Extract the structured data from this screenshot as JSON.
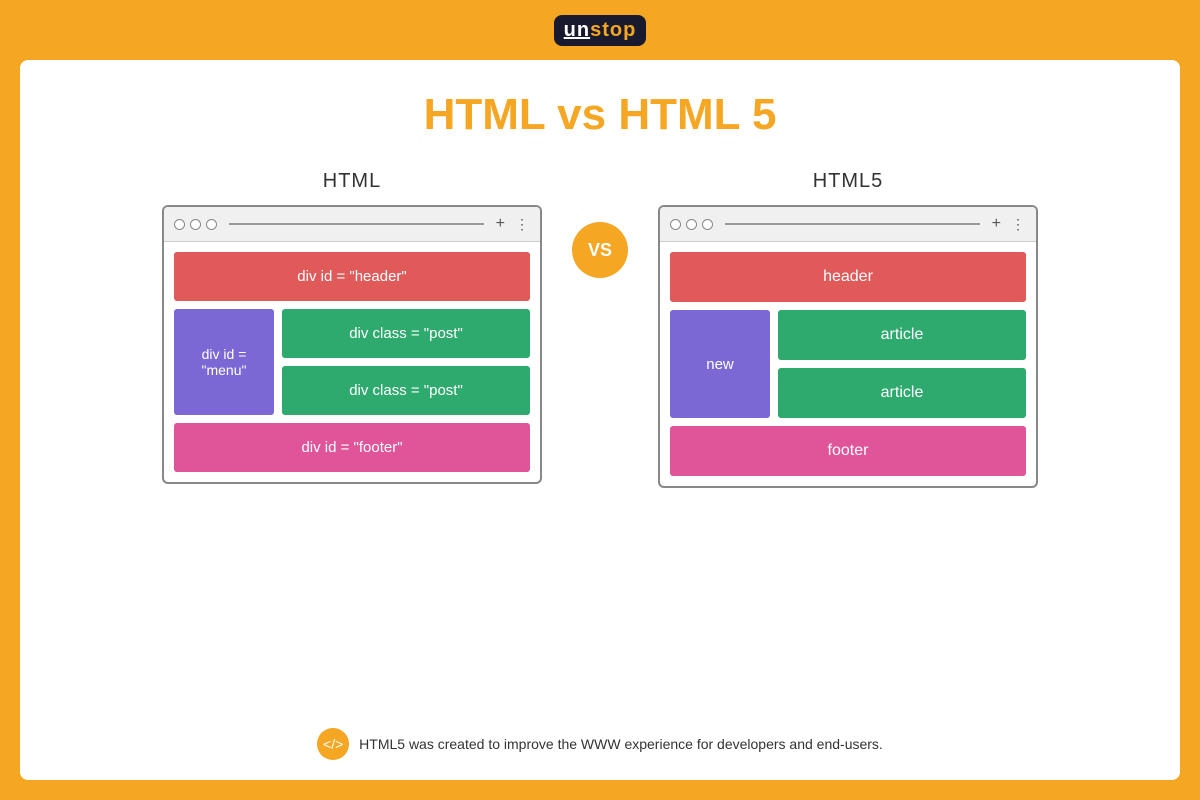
{
  "topbar": {
    "logo_un": "un",
    "logo_stop": "stop"
  },
  "page": {
    "title": "HTML vs HTML 5"
  },
  "left_side": {
    "label": "HTML",
    "browser": {
      "header": "div id = \"header\"",
      "menu": "div id =\n\"menu\"",
      "post1": "div class = \"post\"",
      "post2": "div class = \"post\"",
      "footer": "div id = \"footer\""
    }
  },
  "vs_label": "VS",
  "right_side": {
    "label": "HTML5",
    "browser": {
      "header": "header",
      "nav": "new",
      "article1": "article",
      "article2": "article",
      "footer": "footer"
    }
  },
  "footer_note": "HTML5 was created to improve the WWW experience for developers and end-users.",
  "footer_icon": "</>",
  "browser_ui": {
    "plus": "+",
    "dots_menu": "⋮"
  }
}
